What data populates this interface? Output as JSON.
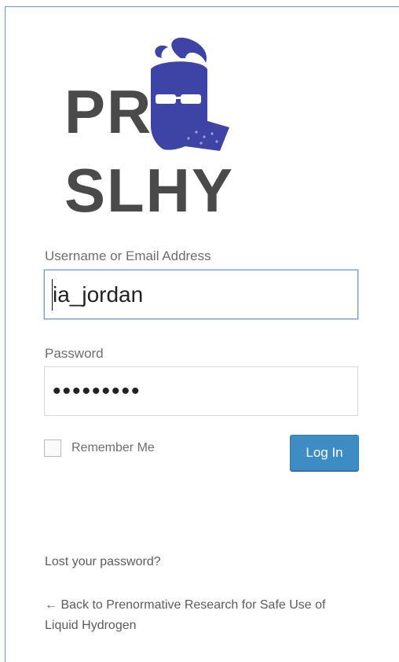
{
  "logo": {
    "wordmark": "PRESLHY",
    "colors": {
      "text": "#4a4a4a",
      "mascot": "#3d44a6"
    }
  },
  "login_form": {
    "username_label": "Username or Email Address",
    "username_value": "ia_jordan",
    "password_label": "Password",
    "password_value": "•••••••••",
    "remember_label": "Remember Me",
    "remember_checked": false,
    "submit_label": "Log In"
  },
  "links": {
    "lost_password": "Lost your password?",
    "back_to_site": "← Back to Prenormative Research for Safe Use of Liquid Hydrogen"
  },
  "colors": {
    "accent": "#3d8cc4",
    "frame": "#6c95c8"
  }
}
